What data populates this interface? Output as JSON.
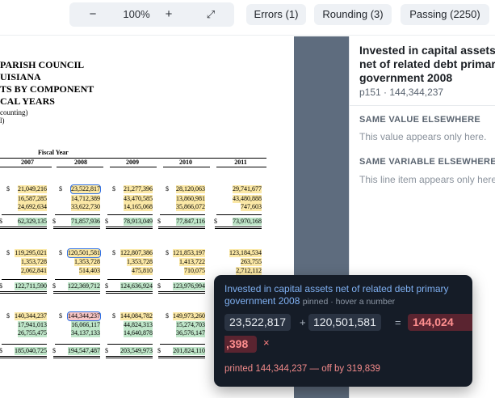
{
  "toolbar": {
    "zoom_out": "−",
    "zoom_level": "100%",
    "zoom_in": "+",
    "fit_icon": "⤢",
    "filters": [
      {
        "label": "Errors (1)"
      },
      {
        "label": "Rounding (3)"
      },
      {
        "label": "Passing (2250)"
      }
    ]
  },
  "document": {
    "heading_lines": [
      "PARISH COUNCIL",
      "UISIANA",
      "TS BY COMPONENT",
      "CAL YEARS"
    ],
    "sub_lines": [
      "counting)",
      "l)"
    ],
    "fiscal_year_label": "Fiscal Year",
    "years": [
      "2007",
      "2008",
      "2009",
      "2010",
      "2011"
    ],
    "groups": [
      {
        "rows": [
          [
            "21,049,216",
            "23,522,817",
            "21,277,396",
            "28,120,063",
            "29,741,677"
          ],
          [
            "16,587,285",
            "14,712,389",
            "43,470,585",
            "13,860,981",
            "43,480,888"
          ],
          [
            "24,692,634",
            "33,622,730",
            "14,165,068",
            "35,866,072",
            "747,603"
          ]
        ],
        "total": [
          "62,329,135",
          "71,857,936",
          "78,913,049",
          "77,847,116",
          "73,970,168"
        ]
      },
      {
        "rows": [
          [
            "119,295,021",
            "120,501,581",
            "122,807,386",
            "121,853,197",
            "123,184,534"
          ],
          [
            "1,353,728",
            "1,353,728",
            "1,353,728",
            "1,413,722",
            "263,755"
          ],
          [
            "2,062,841",
            "514,403",
            "475,810",
            "710,075",
            "2,712,112"
          ]
        ],
        "total": [
          "122,711,590",
          "122,369,712",
          "124,636,924",
          "123,976,994",
          ""
        ]
      },
      {
        "rows": [
          [
            "140,344,237",
            "144,344,237",
            "144,084,782",
            "149,973,260",
            ""
          ],
          [
            "17,941,013",
            "16,066,117",
            "44,824,313",
            "15,274,703",
            ""
          ],
          [
            "26,755,475",
            "34,137,133",
            "14,640,878",
            "36,576,147",
            ""
          ]
        ],
        "total": [
          "185,040,725",
          "194,547,487",
          "203,549,973",
          "201,824,110",
          ""
        ]
      }
    ],
    "dollar_sign": "$"
  },
  "panel": {
    "title": "Invested in capital assets net of related debt primary government 2008",
    "subtitle": "p151 · 144,344,237",
    "same_value_heading": "SAME VALUE ELSEWHERE",
    "same_value_note": "This value appears only here.",
    "same_variable_heading": "SAME VARIABLE ELSEWHERE",
    "same_variable_note": "This line item appears only here."
  },
  "popover": {
    "title": "Invested in capital assets net of related debt primary government 2008",
    "hint": "pinned · hover a number",
    "operand_1": "23,522,817",
    "plus": "+",
    "operand_2": "120,501,581",
    "equals": "=",
    "result_line1": "144,024",
    "result_line2": ",398",
    "mark": "×",
    "message": "printed 144,344,237 — off by 319,839"
  },
  "colors": {
    "highlight_yellow": "#fbe8a6",
    "highlight_green": "#bfe6c9",
    "error_red": "#f7c6c6",
    "selection_blue": "#2f6fe4",
    "gutter": "#5e6c7e",
    "popover_bg": "#151c27"
  }
}
